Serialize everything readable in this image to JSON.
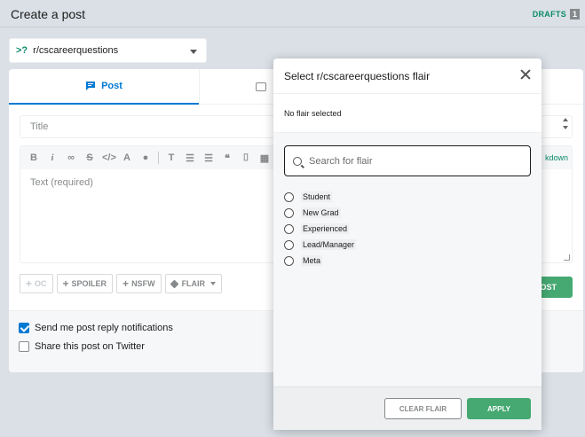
{
  "header": {
    "title": "Create a post",
    "drafts_label": "DRAFTS",
    "drafts_count": "1"
  },
  "community": {
    "mark": ">?",
    "name": "r/cscareerquestions"
  },
  "tabs": [
    {
      "label": "Post",
      "icon": "post-icon"
    },
    {
      "label": "",
      "icon": "image-icon"
    }
  ],
  "form": {
    "title_placeholder": "Title",
    "body_placeholder": "Text (required)",
    "markdown_link": "kdown",
    "post_button": "OST"
  },
  "options": {
    "oc": "OC",
    "spoiler": "SPOILER",
    "nsfw": "NSFW",
    "flair": "FLAIR"
  },
  "notifications": {
    "reply_label": "Send me post reply notifications",
    "reply_checked": true,
    "twitter_label": "Share this post on Twitter",
    "twitter_checked": false
  },
  "modal": {
    "title": "Select r/cscareerquestions flair",
    "no_selection": "No flair selected",
    "search_placeholder": "Search for flair",
    "flairs": [
      "Student",
      "New Grad",
      "Experienced",
      "Lead/Manager",
      "Meta"
    ],
    "clear_button": "CLEAR FLAIR",
    "apply_button": "APPLY"
  },
  "colors": {
    "accent": "#0079d3",
    "green": "#46a972",
    "background": "#dae0e6"
  }
}
